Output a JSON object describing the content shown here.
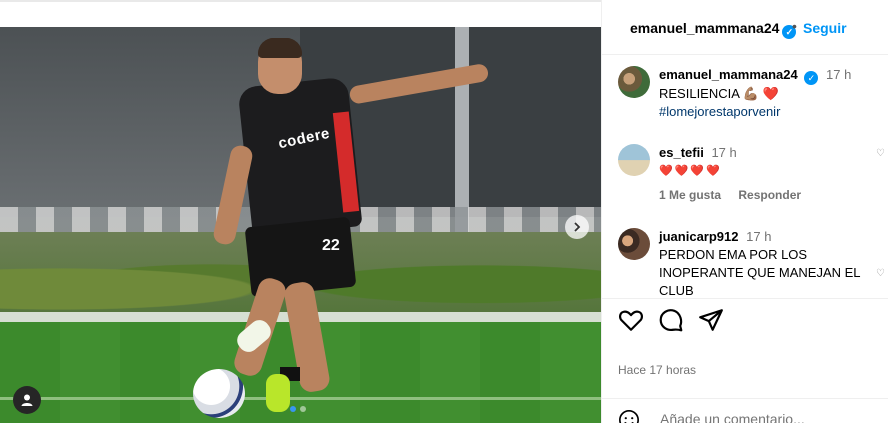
{
  "post": {
    "username": "emanuel_mammana24",
    "follow_label": "Seguir",
    "image_sponsor": "codere",
    "image_number": "22"
  },
  "comments": [
    {
      "username": "emanuel_mammana24",
      "time": "17 h",
      "text": "RESILIENCIA 💪🏽 ❤️",
      "hashtag": "#lomejorestaporvenir"
    },
    {
      "username": "es_tefii",
      "time": "17 h",
      "text": "❤️❤️❤️❤️",
      "likes": "1 Me gusta",
      "reply": "Responder"
    },
    {
      "username": "juanicarp912",
      "time": "17 h",
      "text": "PERDON EMA POR LOS INOPERANTE QUE MANEJAN EL CLUB"
    }
  ],
  "time_ago": "Hace 17 horas",
  "add_comment_placeholder": "Añade un comentario..."
}
